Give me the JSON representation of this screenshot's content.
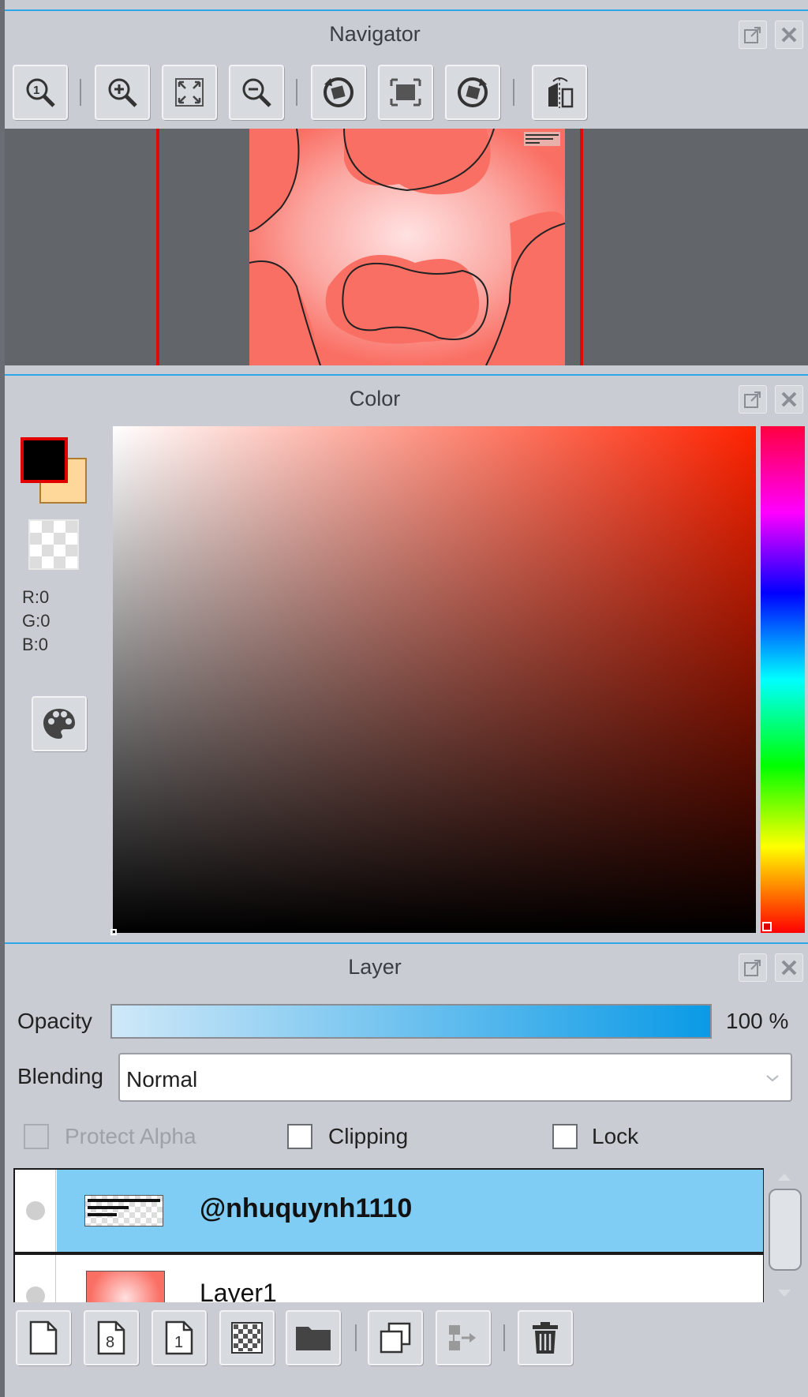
{
  "navigator": {
    "title": "Navigator",
    "toolbar": [
      "zoom-actual-icon",
      "zoom-in-icon",
      "fit-to-window-icon",
      "zoom-out-icon",
      "rotate-left-icon",
      "reset-view-icon",
      "rotate-right-icon",
      "flip-horizontal-icon"
    ]
  },
  "color": {
    "title": "Color",
    "foreground": "#000000",
    "background": "#fed89a",
    "hue_color": "#ff2200",
    "r_label": "R:0",
    "g_label": "G:0",
    "b_label": "B:0"
  },
  "layer": {
    "title": "Layer",
    "opacity_label": "Opacity",
    "opacity_value": "100 %",
    "opacity_fraction": 1.0,
    "blending_label": "Blending",
    "blending_value": "Normal",
    "protect_alpha_label": "Protect Alpha",
    "clipping_label": "Clipping",
    "lock_label": "Lock",
    "rows": [
      {
        "name": "@nhuquynh1110",
        "selected": true
      },
      {
        "name": "Layer1",
        "selected": false
      }
    ],
    "toolbar": [
      "new-layer-icon",
      "new-8bit-layer-icon",
      "new-1bit-layer-icon",
      "new-halftone-layer-icon",
      "new-folder-icon",
      "duplicate-layer-icon",
      "merge-down-icon",
      "delete-layer-icon"
    ]
  },
  "colors": {
    "accent": "#2ea7e8",
    "selected_row": "#7fcdf5",
    "panel_bg": "#c9cdd3",
    "canvas_pink": "#fa6f64"
  }
}
